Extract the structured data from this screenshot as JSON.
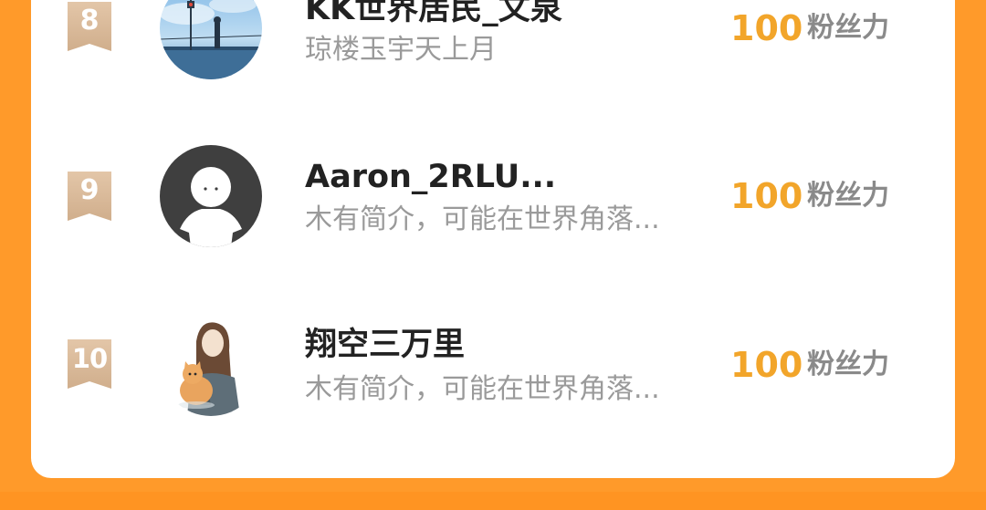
{
  "ranking": {
    "rows": [
      {
        "rank": "8",
        "name": "KK世界居民_文泉",
        "bio": "琼楼玉宇天上月",
        "score": "100",
        "unit": "粉丝力",
        "avatar_icon": "anime-scenery-avatar-icon"
      },
      {
        "rank": "9",
        "name": "Aaron_2RLU...",
        "bio": "木有简介，可能在世界角落...",
        "score": "100",
        "unit": "粉丝力",
        "avatar_icon": "default-user-avatar-icon"
      },
      {
        "rank": "10",
        "name": "翔空三万里",
        "bio": "木有简介，可能在世界角落...",
        "score": "100",
        "unit": "粉丝力",
        "avatar_icon": "girl-with-cat-avatar-icon"
      }
    ]
  },
  "colors": {
    "background": "#FF9A2A",
    "card": "#FFFFFF",
    "score": "#F2A52A",
    "badge": "#D8B89A"
  }
}
